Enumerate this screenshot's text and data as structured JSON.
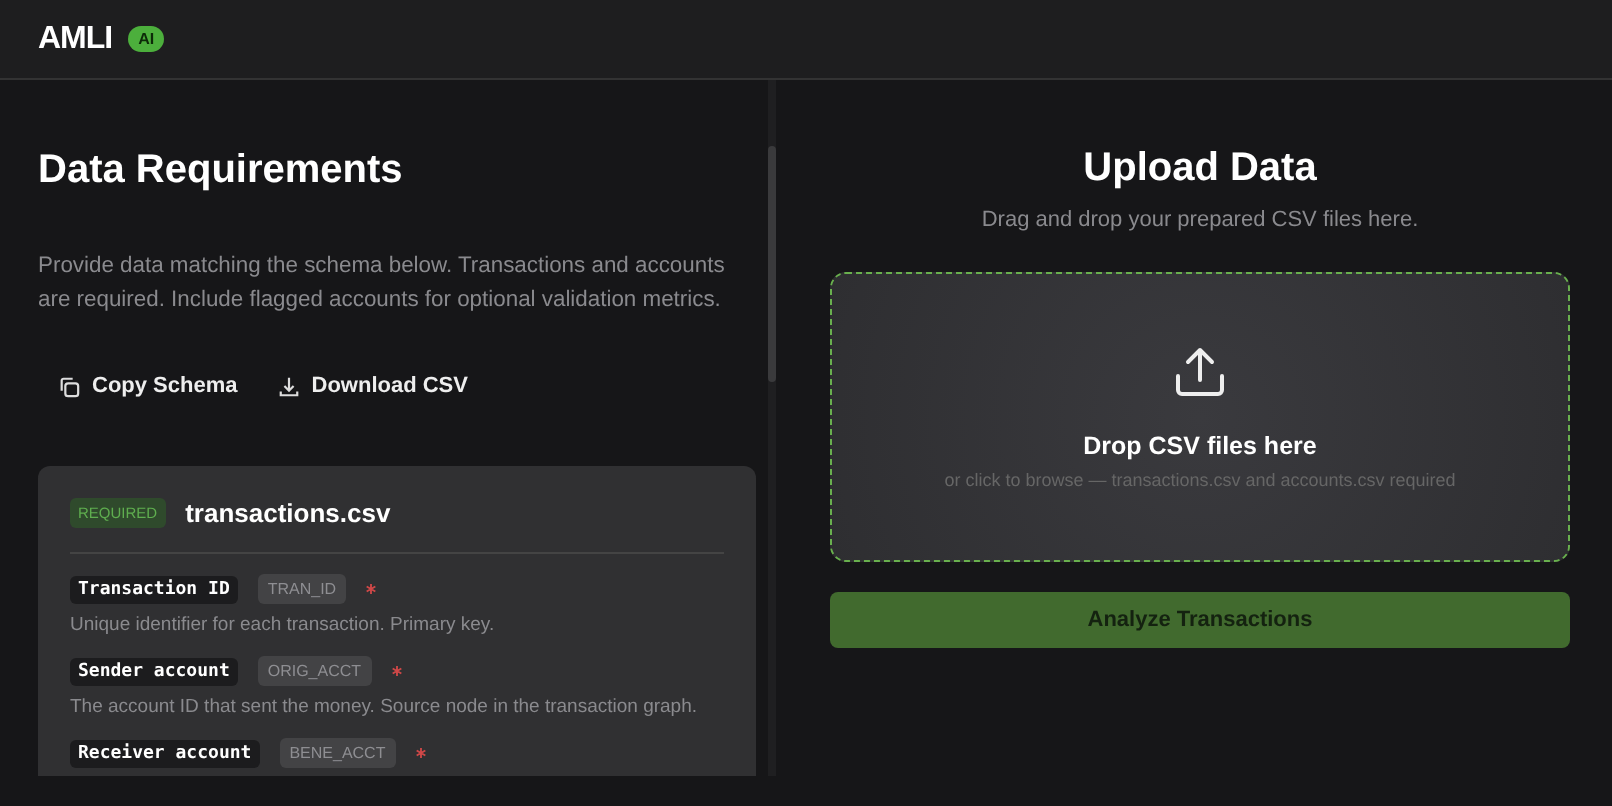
{
  "header": {
    "logo": "AMLI",
    "badge": "AI"
  },
  "requirements": {
    "title": "Data Requirements",
    "description": "Provide data matching the schema below. Transactions and accounts are required. Include flagged accounts for optional validation metrics.",
    "actions": [
      {
        "kind": "copy",
        "label": "Copy Schema"
      },
      {
        "kind": "download",
        "label": "Download CSV"
      }
    ],
    "file": {
      "badge": "REQUIRED",
      "name": "transactions.csv",
      "fields": [
        {
          "label": "Transaction ID",
          "column": "TRAN_ID",
          "required": true,
          "description": "Unique identifier for each transaction. Primary key."
        },
        {
          "label": "Sender account",
          "column": "ORIG_ACCT",
          "required": true,
          "description": "The account ID that sent the money. Source node in the transaction graph."
        },
        {
          "label": "Receiver account",
          "column": "BENE_ACCT",
          "required": true
        }
      ]
    }
  },
  "upload": {
    "title": "Upload Data",
    "subtitle": "Drag and drop your prepared CSV files here.",
    "drop_title": "Drop CSV files here",
    "drop_hint": "or click to browse — transactions.csv and accounts.csv required",
    "button": "Analyze Transactions"
  }
}
